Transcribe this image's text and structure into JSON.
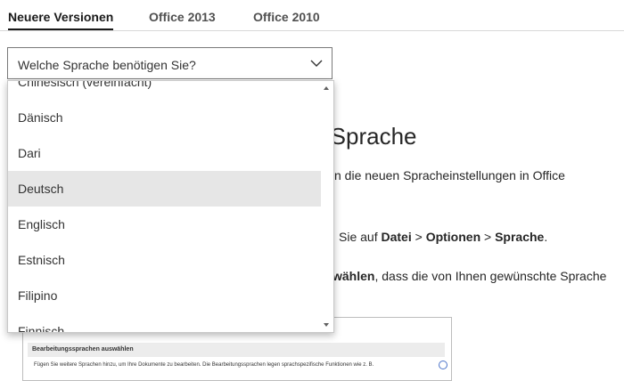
{
  "tabs": [
    {
      "label": "Neuere Versionen",
      "active": true
    },
    {
      "label": "Office 2013",
      "active": false
    },
    {
      "label": "Office 2010",
      "active": false
    }
  ],
  "dropdown": {
    "placeholder": "Welche Sprache benötigen Sie?",
    "items": [
      "Chinesisch (vereinfacht)",
      "Dänisch",
      "Dari",
      "Deutsch",
      "Englisch",
      "Estnisch",
      "Filipino",
      "Finnisch"
    ],
    "selected": "Deutsch"
  },
  "article": {
    "heading_visible": "-Sprache",
    "p1": "n die neuen Spracheinstellungen in Office",
    "p2": {
      "prefix": "Sie auf ",
      "datei": "Datei",
      "sep1": " > ",
      "optionen": "Optionen",
      "sep2": " > ",
      "sprache": "Sprache",
      "suffix": "."
    },
    "p3": {
      "bold": "wählen",
      "rest": ", dass die von Ihnen gewünschte Sprache"
    }
  },
  "preview": {
    "title": "Bearbeitungssprachen auswählen",
    "text": "Fügen Sie weitere Sprachen hinzu, um Ihre Dokumente zu bearbeiten. Die Bearbeitungssprachen legen sprachspezifische Funktionen wie z. B."
  },
  "colors": {
    "text": "#1a1a1a",
    "border": "#7a7a7a",
    "selected_bg": "#e6e6e6",
    "info_icon": "#4b73c9"
  }
}
